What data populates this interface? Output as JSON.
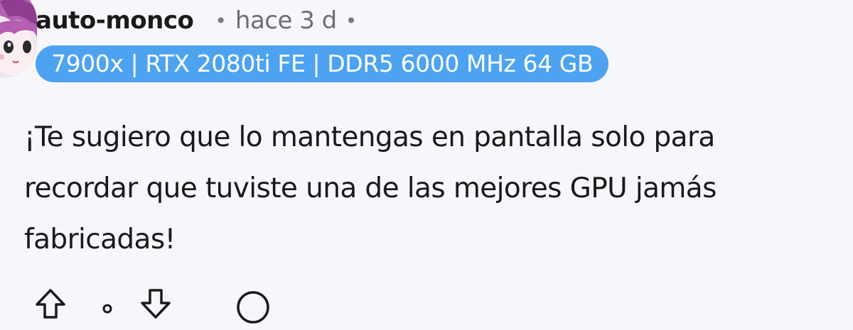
{
  "comment": {
    "username": "auto-monco",
    "separator": "•",
    "timestamp": "hace 3 d",
    "flair": "7900x | RTX 2080ti FE | DDR5 6000 MHz 64 GB",
    "flair_color": "#4da3f0",
    "body_lines": [
      "¡Te sugiero que lo mantengas en pantalla solo para",
      "recordar que tuviste una de las mejores GPU jamás",
      "fabricadas!"
    ]
  },
  "actions": {
    "upvote_icon": "upvote-arrow-icon",
    "downvote_icon": "downvote-arrow-icon",
    "reply_icon": "speech-bubble-icon"
  }
}
